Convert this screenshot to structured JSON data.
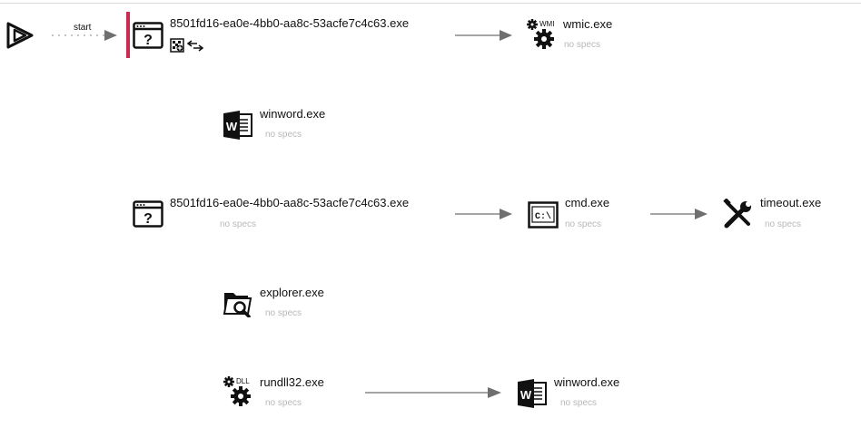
{
  "start_label": "start",
  "no_specs": "no specs",
  "colors": {
    "accent_bar": "#d6244a",
    "arrow": "#6f6f6f",
    "muted_text": "#b8b8b8"
  },
  "nodes": [
    {
      "id": "root",
      "icon": "unknown-window-icon",
      "label": "8501fd16-ea0e-4bb0-aa8c-53acfe7c4c63.exe",
      "badges": [
        "network-icon",
        "swap-arrows-icon"
      ],
      "highlighted": true
    },
    {
      "id": "wmic",
      "icon": "wmi-gear-icon",
      "icon_text": "WMI",
      "label": "wmic.exe",
      "spec": "no specs"
    },
    {
      "id": "winword1",
      "icon": "word-icon",
      "icon_text": "W",
      "label": "winword.exe",
      "spec": "no specs"
    },
    {
      "id": "child",
      "icon": "unknown-window-icon",
      "label": "8501fd16-ea0e-4bb0-aa8c-53acfe7c4c63.exe",
      "spec": "no specs"
    },
    {
      "id": "cmd",
      "icon": "cmd-icon",
      "icon_text": "C:\\",
      "label": "cmd.exe",
      "spec": "no specs"
    },
    {
      "id": "timeout",
      "icon": "tools-icon",
      "label": "timeout.exe",
      "spec": "no specs"
    },
    {
      "id": "explorer",
      "icon": "folder-search-icon",
      "label": "explorer.exe",
      "spec": "no specs"
    },
    {
      "id": "rundll",
      "icon": "dll-gear-icon",
      "icon_text": "DLL",
      "label": "rundll32.exe",
      "spec": "no specs"
    },
    {
      "id": "winword2",
      "icon": "word-icon",
      "icon_text": "W",
      "label": "winword.exe",
      "spec": "no specs"
    }
  ]
}
